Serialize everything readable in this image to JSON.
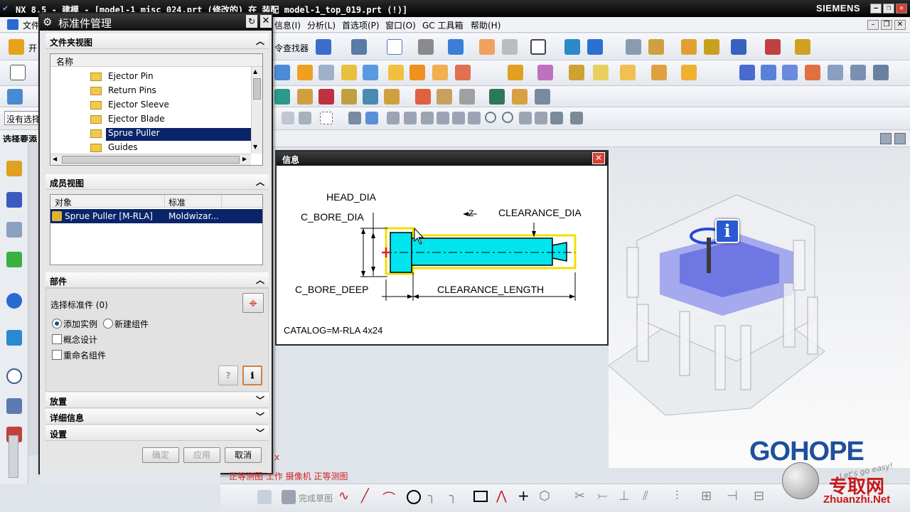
{
  "titlebar": {
    "title": "NX 8.5 - 建模 - [model-1_misc_024.prt (修改的) 在 装配 model-1_top_019.prt (!)]",
    "brand": "SIEMENS"
  },
  "menubar": {
    "items": [
      "文件",
      "信息(I)",
      "分析(L)",
      "首选项(P)",
      "窗口(O)",
      "GC 工具箱",
      "帮助(H)"
    ],
    "finder": "令查找器"
  },
  "left_fragments": {
    "start": "开",
    "no_select": "没有选择",
    "select_req": "选择要添",
    "snap_text": "正等测图 工作 摄像机 正等测图",
    "finish_sketch": "完成草图"
  },
  "dialog": {
    "title": "标准件管理",
    "folder_view": {
      "header": "文件夹视图",
      "column": "名称",
      "items": [
        "Ejector Pin",
        "Return Pins",
        "Ejector Sleeve",
        "Ejector Blade",
        "Sprue Puller",
        "Guides"
      ],
      "selected_index": 4
    },
    "member_view": {
      "header": "成员视图",
      "columns": [
        "对象",
        "标准"
      ],
      "rows": [
        {
          "object": "Sprue Puller [M-RLA]",
          "standard": "Moldwizar..."
        }
      ]
    },
    "part": {
      "header": "部件",
      "select_label": "选择标准件 (0)",
      "radio_add": "添加实例",
      "radio_new": "新建组件",
      "check_concept": "概念设计",
      "check_rename": "重命名组件"
    },
    "collapsed": [
      "放置",
      "详细信息",
      "设置"
    ],
    "buttons": {
      "ok": "确定",
      "apply": "应用",
      "cancel": "取消"
    }
  },
  "info": {
    "title": "信息",
    "labels": {
      "head_dia": "HEAD_DIA",
      "c_bore_dia": "C_BORE_DIA",
      "clearance_dia": "CLEARANCE_DIA",
      "c_bore_deep": "C_BORE_DEEP",
      "clearance_length": "CLEARANCE_LENGTH",
      "z": "Z"
    },
    "catalog": "CATALOG=M-RLA 4x24"
  },
  "watermark": {
    "gohope": "GOHOPE",
    "zhuanzhi_cn": "专取网",
    "zhuanzhi_url": "Zhuanzhi.Net",
    "slogan": "Let's go easy!"
  },
  "colors": {
    "accent": "#0a246a",
    "part_fill": "#00e5ee",
    "highlight": "#f0e000",
    "gohope": "#1f4f9c"
  }
}
